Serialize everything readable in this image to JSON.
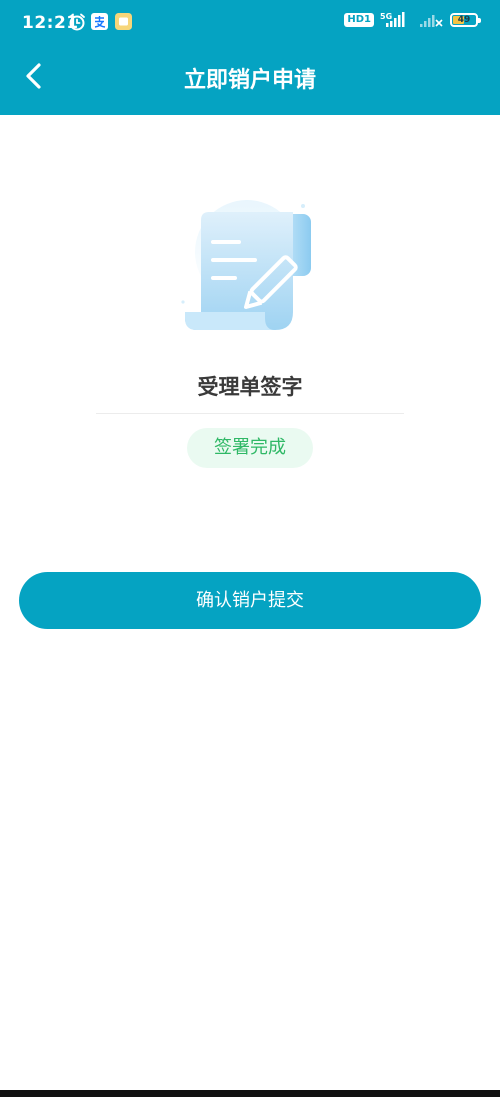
{
  "status_bar": {
    "time": "12:21",
    "network_badge": "HD1",
    "network_type": "5G",
    "battery_level": "49",
    "icons": [
      "alarm-icon",
      "alipay-icon",
      "notification-icon",
      "signal-icon",
      "battery-icon"
    ]
  },
  "header": {
    "title": "立即销户申请",
    "back_icon": "chevron-left-icon"
  },
  "main": {
    "illustration": "document-pen-icon",
    "section_title": "受理单签字",
    "status_badge": "签署完成",
    "submit_label": "确认销户提交"
  },
  "colors": {
    "primary": "#05a3c2",
    "success": "#2fb866",
    "success_bg": "#eafaf1"
  }
}
